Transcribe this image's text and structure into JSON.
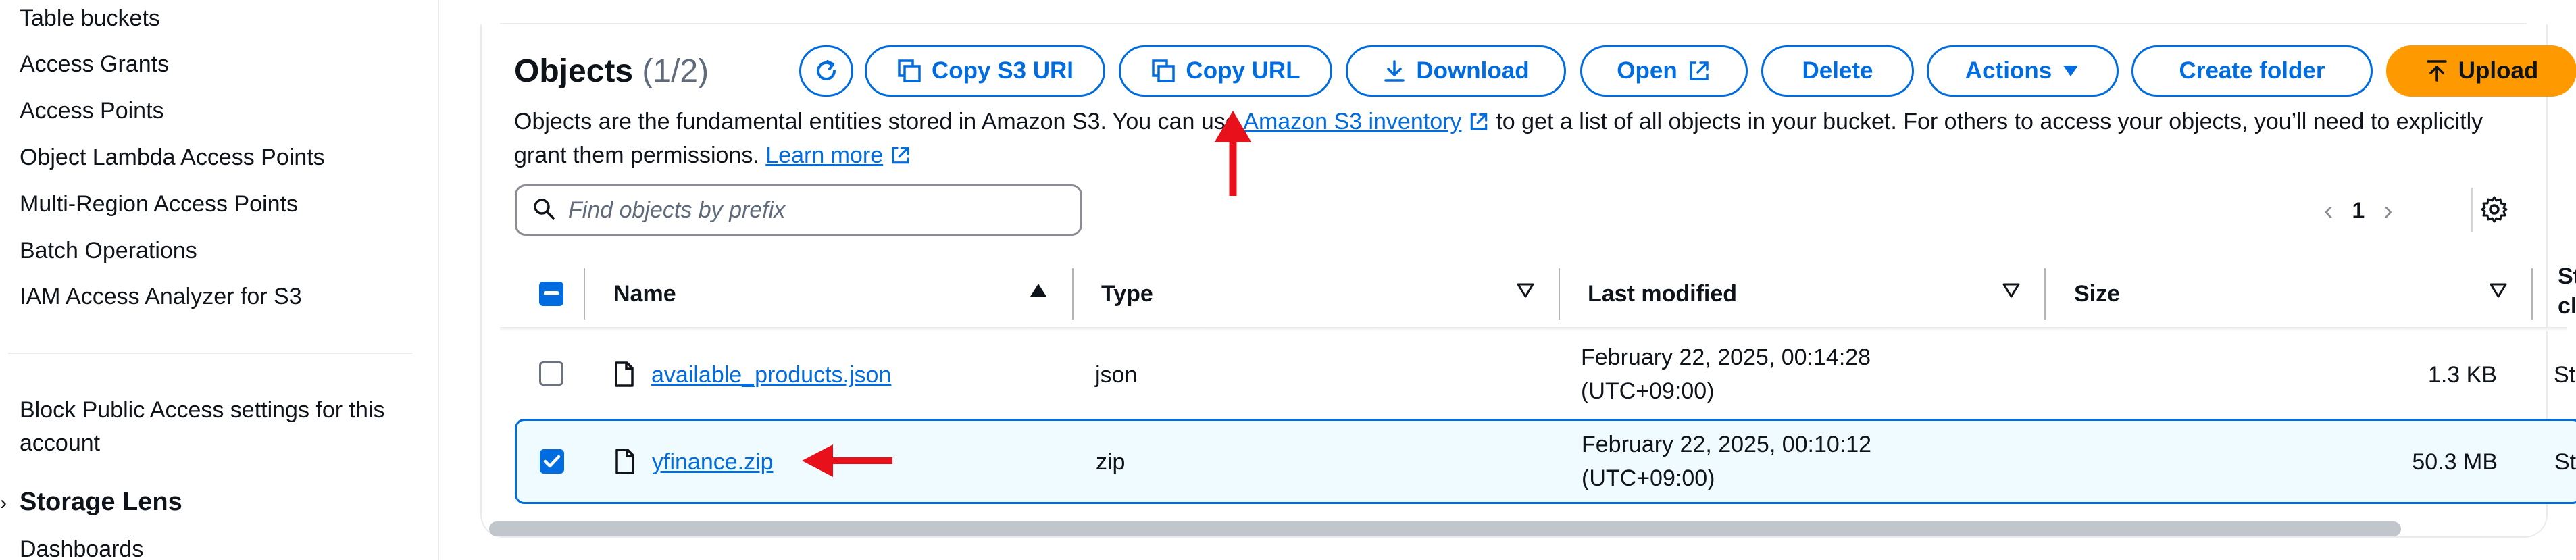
{
  "sidebar": {
    "items": [
      {
        "label": "Table buckets"
      },
      {
        "label": "Access Grants"
      },
      {
        "label": "Access Points"
      },
      {
        "label": "Object Lambda Access Points"
      },
      {
        "label": "Multi-Region Access Points"
      },
      {
        "label": "Batch Operations"
      },
      {
        "label": "IAM Access Analyzer for S3"
      }
    ],
    "block_public_access": "Block Public Access settings for this account",
    "section": "Storage Lens",
    "section_items": [
      {
        "label": "Dashboards"
      }
    ]
  },
  "objects": {
    "title": "Objects",
    "count": "(1/2)",
    "toolbar": {
      "copy_s3_uri": "Copy S3 URI",
      "copy_url": "Copy URL",
      "download": "Download",
      "open": "Open",
      "delete": "Delete",
      "actions": "Actions",
      "create_folder": "Create folder",
      "upload": "Upload"
    },
    "description": {
      "part1": "Objects are the fundamental entities stored in Amazon S3. You can use ",
      "inventory_link": "Amazon S3 inventory",
      "part2": " to get a list of all objects in your bucket. For others to access your objects, you’ll need to explicitly grant them permissions. ",
      "learn_more": "Learn more"
    },
    "search": {
      "placeholder": "Find objects by prefix",
      "value": ""
    },
    "pagination": {
      "page": "1"
    }
  },
  "table": {
    "columns": {
      "name": "Name",
      "type": "Type",
      "last_modified": "Last modified",
      "size": "Size",
      "storage_class_1": "St",
      "storage_class_2": "cl"
    },
    "rows": [
      {
        "name": "available_products.json",
        "type": "json",
        "modified_1": "February 22, 2025, 00:14:28",
        "modified_2": "(UTC+09:00)",
        "size": "1.3 KB",
        "storage": "St",
        "selected": false
      },
      {
        "name": "yfinance.zip",
        "type": "zip",
        "modified_1": "February 22, 2025, 00:10:12",
        "modified_2": "(UTC+09:00)",
        "size": "50.3 MB",
        "storage": "St",
        "selected": true
      }
    ]
  },
  "colors": {
    "accent": "#006ce0",
    "upload": "#ff9900",
    "annotation_arrow": "#e8101a"
  }
}
